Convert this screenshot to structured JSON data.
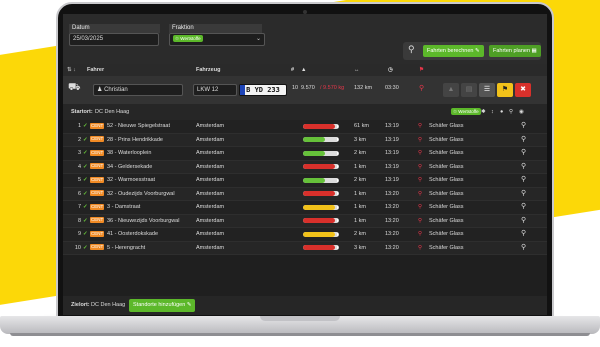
{
  "filters": {
    "date_label": "Datum",
    "date_value": "25/03/2025",
    "fraction_label": "Fraktion",
    "fraction_value": "Wertstoffe"
  },
  "actions": {
    "calculate_label": "Fahrten berechnen",
    "plan_label": "Fahrten planen"
  },
  "columns": {
    "driver": "Fahrer",
    "vehicle": "Fahrzeug",
    "number": "#"
  },
  "driver_row": {
    "name": "Christian",
    "vehicle_type": "LKW 12",
    "plate": "B YD 233",
    "count": "10",
    "load": "9.570",
    "capacity": "/ 9.570 kg",
    "distance": "132 km",
    "time": "03:30"
  },
  "start": {
    "label": "Startort:",
    "value": "DC Den Haag",
    "fraction_badge": "Wertstoffe"
  },
  "badge_text": "CENT",
  "stops": [
    {
      "n": "1",
      "address": "52 - Nieuwe Spiegelstraat",
      "city": "Amsterdam",
      "fill": 0.9,
      "color": "#d8302b",
      "km": "61 km",
      "time": "13:19",
      "customer": "Schäfer Glass"
    },
    {
      "n": "2",
      "address": "28 - Prins Hendrikkade",
      "city": "Amsterdam",
      "fill": 0.6,
      "color": "#66c13a",
      "km": "3 km",
      "time": "13:19",
      "customer": "Schäfer Glass"
    },
    {
      "n": "3",
      "address": "38 - Waterlooplein",
      "city": "Amsterdam",
      "fill": 0.6,
      "color": "#66c13a",
      "km": "2 km",
      "time": "13:19",
      "customer": "Schäfer Glass"
    },
    {
      "n": "4",
      "address": "34 - Geldersekade",
      "city": "Amsterdam",
      "fill": 0.9,
      "color": "#d8302b",
      "km": "1 km",
      "time": "13:19",
      "customer": "Schäfer Glass"
    },
    {
      "n": "5",
      "address": "32 - Warmoesstraat",
      "city": "Amsterdam",
      "fill": 0.6,
      "color": "#66c13a",
      "km": "2 km",
      "time": "13:19",
      "customer": "Schäfer Glass"
    },
    {
      "n": "6",
      "address": "32 - Oudezijds Voorburgwal",
      "city": "Amsterdam",
      "fill": 0.9,
      "color": "#d8302b",
      "km": "1 km",
      "time": "13:20",
      "customer": "Schäfer Glass"
    },
    {
      "n": "7",
      "address": "3 - Damstraat",
      "city": "Amsterdam",
      "fill": 0.9,
      "color": "#f2c21a",
      "km": "1 km",
      "time": "13:20",
      "customer": "Schäfer Glass"
    },
    {
      "n": "8",
      "address": "36 - Nieuwezijds Voorburgwal",
      "city": "Amsterdam",
      "fill": 0.9,
      "color": "#d8302b",
      "km": "1 km",
      "time": "13:20",
      "customer": "Schäfer Glass"
    },
    {
      "n": "9",
      "address": "41 - Oosterdokskade",
      "city": "Amsterdam",
      "fill": 0.9,
      "color": "#f2c21a",
      "km": "2 km",
      "time": "13:20",
      "customer": "Schäfer Glass"
    },
    {
      "n": "10",
      "address": "5 - Herengracht",
      "city": "Amsterdam",
      "fill": 0.9,
      "color": "#d8302b",
      "km": "3 km",
      "time": "13:20",
      "customer": "Schäfer Glass"
    }
  ],
  "end": {
    "label": "Zielort:",
    "value": "DC Den Haag",
    "add_label": "Standorte hinzufügen"
  },
  "colors": {
    "accent": "#5cb82a",
    "danger": "#d8302b",
    "warning": "#f2c21a",
    "brand_yellow": "#fcd808"
  }
}
